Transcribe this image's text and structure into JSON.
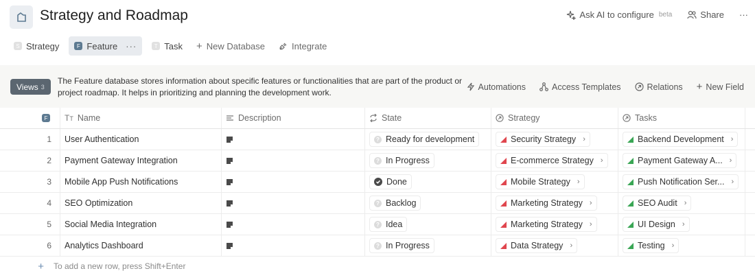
{
  "header": {
    "title": "Strategy and Roadmap",
    "ask_ai_label": "Ask AI to configure",
    "beta_label": "beta",
    "share_label": "Share",
    "more_label": "···"
  },
  "tabs": [
    {
      "label": "Strategy",
      "badge": "S"
    },
    {
      "label": "Feature",
      "badge": "F",
      "more": "···"
    },
    {
      "label": "Task",
      "badge": "T"
    },
    {
      "label": "New Database",
      "icon": "+"
    },
    {
      "label": "Integrate"
    }
  ],
  "infobar": {
    "views_label": "Views",
    "views_count": "3",
    "description": "The Feature database stores information about specific features or functionalities that are part of the product or project roadmap. It helps in prioritizing and planning the development work.",
    "automations_label": "Automations",
    "access_templates_label": "Access Templates",
    "relations_label": "Relations",
    "new_field_label": "New Field"
  },
  "table": {
    "index_badge": "F",
    "columns": {
      "name": "Name",
      "description": "Description",
      "state": "State",
      "strategy": "Strategy",
      "tasks": "Tasks"
    },
    "rows": [
      {
        "index": "1",
        "name": "User Authentication",
        "state": "Ready for development",
        "strategy": "Security Strategy",
        "task": "Backend Development"
      },
      {
        "index": "2",
        "name": "Payment Gateway Integration",
        "state": "In Progress",
        "strategy": "E-commerce Strategy",
        "task": "Payment Gateway A..."
      },
      {
        "index": "3",
        "name": "Mobile App Push Notifications",
        "state": "Done",
        "strategy": "Mobile Strategy",
        "task": "Push Notification Ser..."
      },
      {
        "index": "4",
        "name": "SEO Optimization",
        "state": "Backlog",
        "strategy": "Marketing Strategy",
        "task": "SEO Audit"
      },
      {
        "index": "5",
        "name": "Social Media Integration",
        "state": "Idea",
        "strategy": "Marketing Strategy",
        "task": "UI Design"
      },
      {
        "index": "6",
        "name": "Analytics Dashboard",
        "state": "In Progress",
        "strategy": "Data Strategy",
        "task": "Testing"
      }
    ],
    "add_row_hint": "To add a new row, press Shift+Enter"
  },
  "colors": {
    "accent": "#5d7a91",
    "views_button": "#5b6670",
    "strategy_flag": "#e0464e",
    "task_flag": "#3aa655"
  }
}
